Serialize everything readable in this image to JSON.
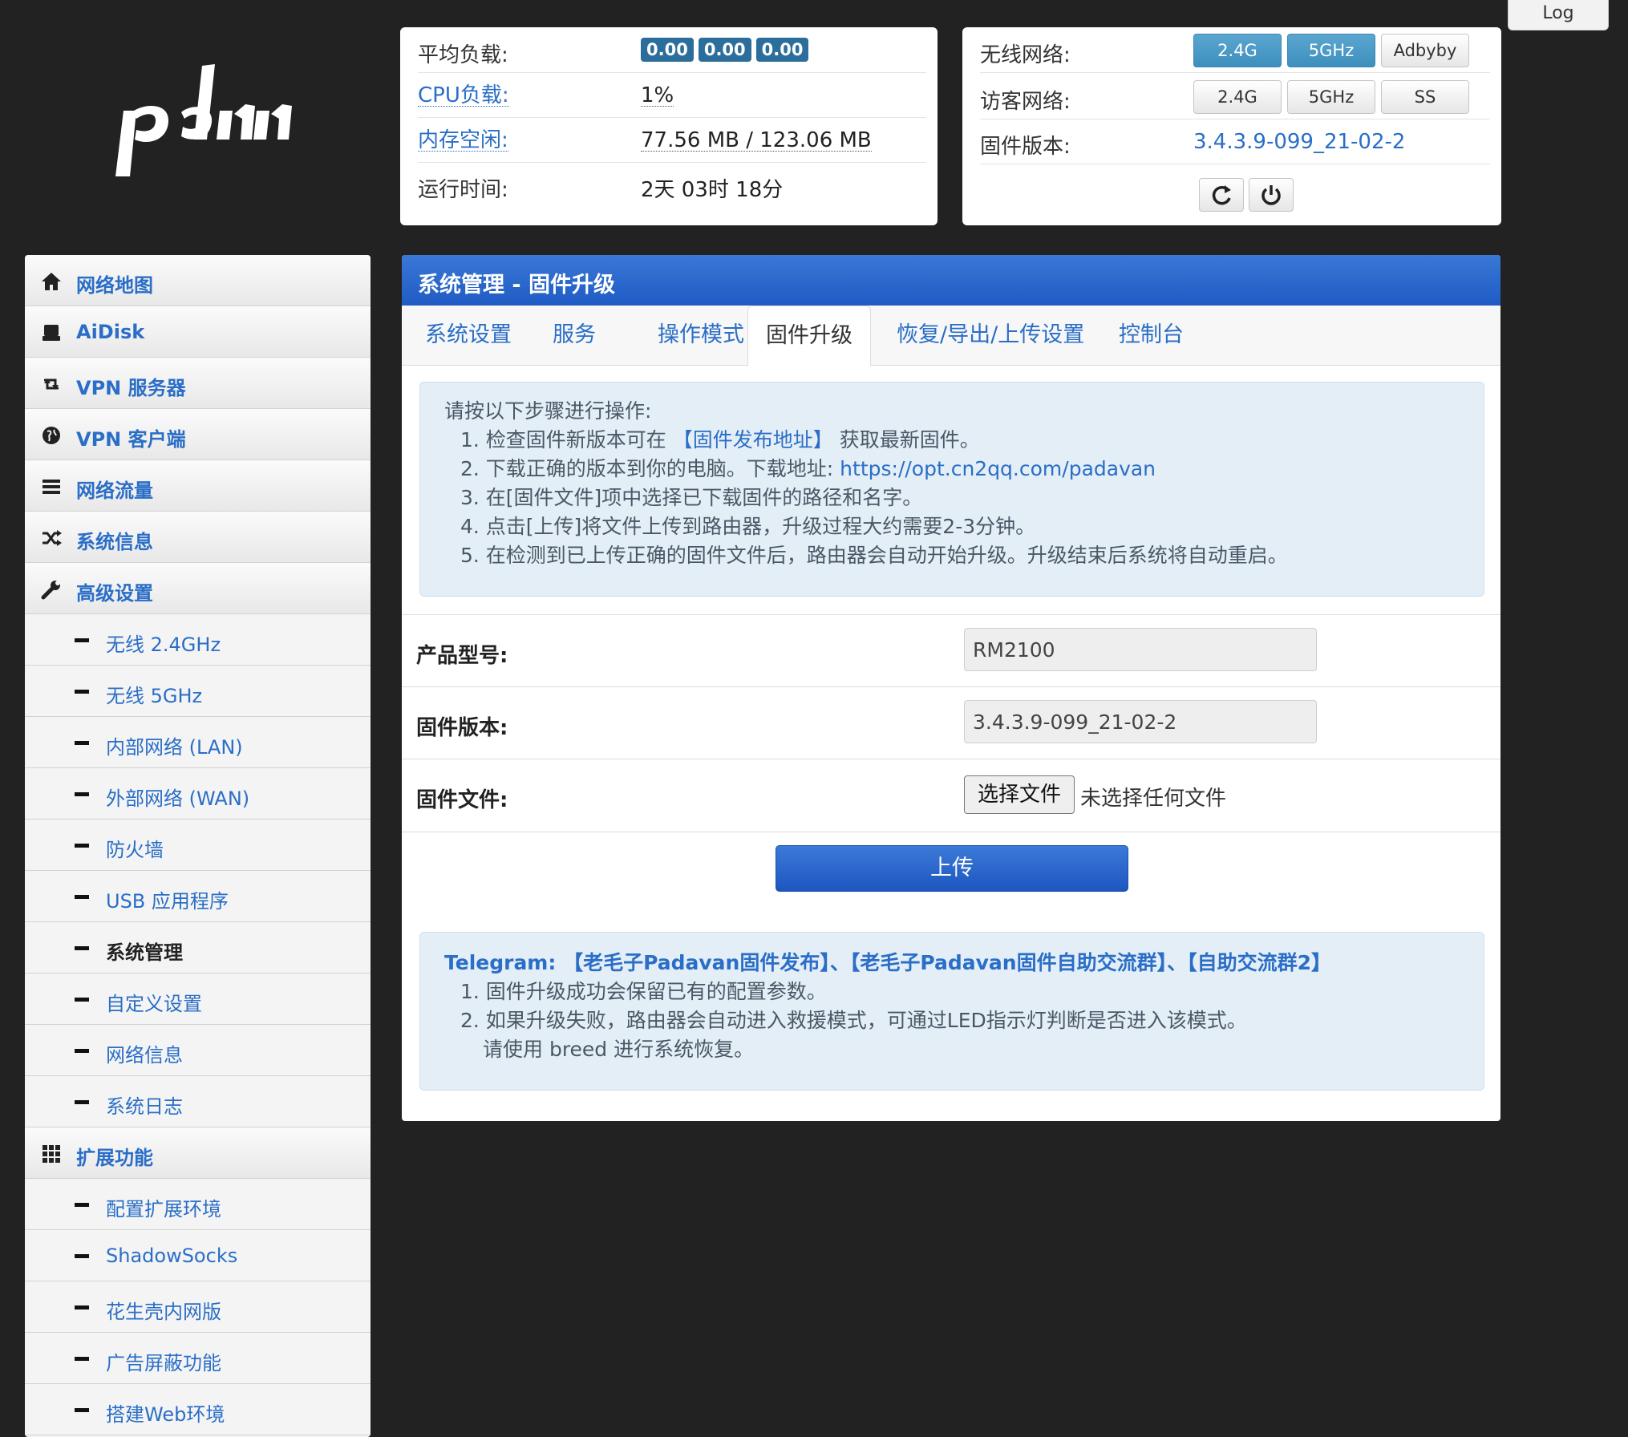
{
  "logo_text": "pdan",
  "log_button": "Log",
  "status_left": {
    "load_label": "平均负载:",
    "load_values": [
      "0.00",
      "0.00",
      "0.00"
    ],
    "cpu_label": "CPU负载:",
    "cpu_value": "1%",
    "mem_label": "内存空闲:",
    "mem_value": "77.56 MB / 123.06 MB",
    "uptime_label": "运行时间:",
    "uptime_value": "2天 03时 18分"
  },
  "status_right": {
    "wireless_label": "无线网络:",
    "wireless_buttons": [
      "2.4G",
      "5GHz",
      "Adbyby"
    ],
    "guest_label": "访客网络:",
    "guest_buttons": [
      "2.4G",
      "5GHz",
      "SS"
    ],
    "firmware_label": "固件版本:",
    "firmware_value": "3.4.3.9-099_21-02-2"
  },
  "sidebar": {
    "items": [
      {
        "label": "网络地图",
        "icon": "home-icon"
      },
      {
        "label": "AiDisk",
        "icon": "disk-icon"
      },
      {
        "label": "VPN 服务器",
        "icon": "retweet-icon"
      },
      {
        "label": "VPN 客户端",
        "icon": "globe-icon"
      },
      {
        "label": "网络流量",
        "icon": "list-icon"
      },
      {
        "label": "系统信息",
        "icon": "shuffle-icon"
      },
      {
        "label": "高级设置",
        "icon": "wrench-icon"
      },
      {
        "label": "无线 2.4GHz"
      },
      {
        "label": "无线 5GHz"
      },
      {
        "label": "内部网络 (LAN)"
      },
      {
        "label": "外部网络 (WAN)"
      },
      {
        "label": "防火墙"
      },
      {
        "label": "USB 应用程序"
      },
      {
        "label": "系统管理"
      },
      {
        "label": "自定义设置"
      },
      {
        "label": "网络信息"
      },
      {
        "label": "系统日志"
      },
      {
        "label": "扩展功能",
        "icon": "grid-icon"
      },
      {
        "label": "配置扩展环境"
      },
      {
        "label": "ShadowSocks"
      },
      {
        "label": "花生壳内网版"
      },
      {
        "label": "广告屏蔽功能"
      },
      {
        "label": "搭建Web环境"
      }
    ]
  },
  "main": {
    "title": "系统管理 - 固件升级",
    "tabs": [
      "系统设置",
      "服务",
      "操作模式",
      "固件升级",
      "恢复/导出/上传设置",
      "控制台"
    ],
    "instructions": {
      "heading": "请按以下步骤进行操作:",
      "step1_prefix": "1. 检查固件新版本可在 ",
      "step1_link": "【固件发布地址】",
      "step1_suffix": " 获取最新固件。",
      "step2_prefix": "2. 下载正确的版本到你的电脑。下载地址: ",
      "step2_link": "https://opt.cn2qq.com/padavan",
      "step3": "3. 在[固件文件]项中选择已下载固件的路径和名字。",
      "step4": "4. 点击[上传]将文件上传到路由器，升级过程大约需要2-3分钟。",
      "step5": "5. 在检测到已上传正确的固件文件后，路由器会自动开始升级。升级结束后系统将自动重启。"
    },
    "form": {
      "model_label": "产品型号:",
      "model_value": "RM2100",
      "fw_label": "固件版本:",
      "fw_value": "3.4.3.9-099_21-02-2",
      "file_label": "固件文件:",
      "file_button": "选择文件",
      "file_none": "未选择任何文件"
    },
    "upload_button": "上传",
    "notes": {
      "telegram": "Telegram: ",
      "link1": "【老毛子Padavan固件发布】",
      "sep1": "、",
      "link2": "【老毛子Padavan固件自助交流群】",
      "sep2": "、",
      "link3": "【自助交流群2】",
      "note1": "1. 固件升级成功会保留已有的配置参数。",
      "note2": "2. 如果升级失败，路由器会自动进入救援模式，可通过LED指示灯判断是否进入该模式。",
      "note3": "请使用 breed 进行系统恢复。"
    }
  }
}
